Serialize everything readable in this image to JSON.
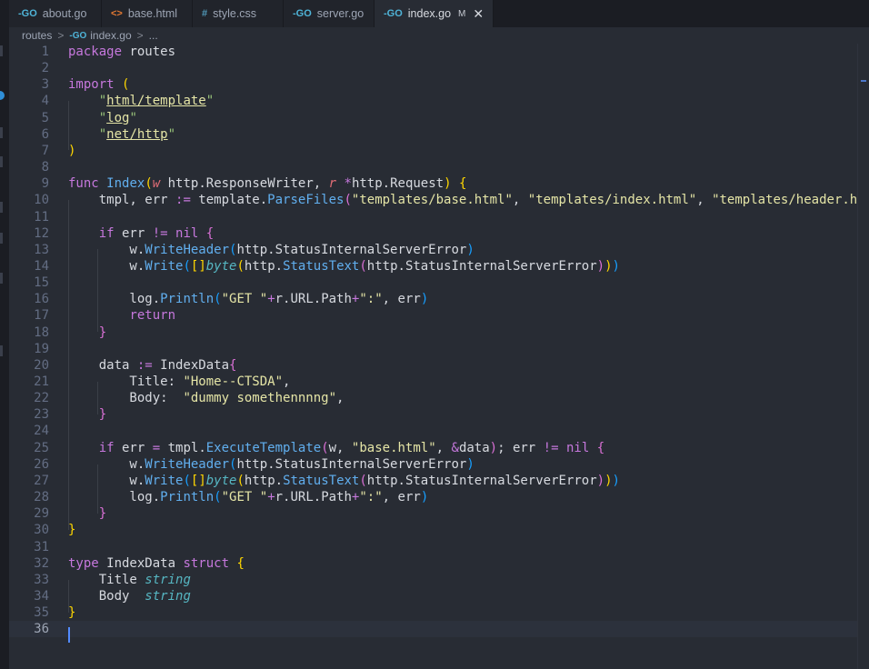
{
  "tabs": [
    {
      "icon": "go-icon",
      "icon_text": "-GO",
      "label": "about.go",
      "active": false
    },
    {
      "icon": "html-icon",
      "icon_text": "<>",
      "label": "base.html",
      "active": false
    },
    {
      "icon": "css-icon",
      "icon_text": "#",
      "label": "style.css",
      "active": false
    },
    {
      "icon": "go-icon",
      "icon_text": "-GO",
      "label": "server.go",
      "active": false
    },
    {
      "icon": "go-icon",
      "icon_text": "-GO",
      "label": "index.go",
      "active": true,
      "modified": "M",
      "close": "✕"
    }
  ],
  "breadcrumb": {
    "folder": "routes",
    "sep": ">",
    "file_icon_text": "-GO",
    "file": "index.go",
    "tail": "..."
  },
  "editor": {
    "current_line": 36,
    "line_numbers": [
      "1",
      "2",
      "3",
      "4",
      "5",
      "6",
      "7",
      "8",
      "9",
      "10",
      "11",
      "12",
      "13",
      "14",
      "15",
      "16",
      "17",
      "18",
      "19",
      "20",
      "21",
      "22",
      "23",
      "24",
      "25",
      "26",
      "27",
      "28",
      "29",
      "30",
      "31",
      "32",
      "33",
      "34",
      "35",
      "36"
    ],
    "lines": [
      [
        [
          "kw",
          "package"
        ],
        [
          "pkg",
          " routes"
        ]
      ],
      [],
      [
        [
          "kw",
          "import"
        ],
        [
          "pkg",
          " "
        ],
        [
          "br1",
          "("
        ]
      ],
      [
        [
          "pkg",
          "    "
        ],
        [
          "strq",
          "\""
        ],
        [
          "str ul",
          "html/template"
        ],
        [
          "strq",
          "\""
        ]
      ],
      [
        [
          "pkg",
          "    "
        ],
        [
          "strq",
          "\""
        ],
        [
          "str ul",
          "log"
        ],
        [
          "strq",
          "\""
        ]
      ],
      [
        [
          "pkg",
          "    "
        ],
        [
          "strq",
          "\""
        ],
        [
          "str ul",
          "net/http"
        ],
        [
          "strq",
          "\""
        ]
      ],
      [
        [
          "br1",
          ")"
        ]
      ],
      [],
      [
        [
          "kw",
          "func"
        ],
        [
          "pkg",
          " "
        ],
        [
          "fn",
          "Index"
        ],
        [
          "br1",
          "("
        ],
        [
          "tpar",
          "w"
        ],
        [
          "pkg",
          " http.ResponseWriter, "
        ],
        [
          "tpar",
          "r"
        ],
        [
          "pkg",
          " "
        ],
        [
          "kw",
          "*"
        ],
        [
          "pkg",
          "http.Request"
        ],
        [
          "br1",
          ")"
        ],
        [
          "pkg",
          " "
        ],
        [
          "br1",
          "{"
        ]
      ],
      [
        [
          "pkg",
          "    tmpl, err "
        ],
        [
          "kw",
          ":="
        ],
        [
          "pkg",
          " template."
        ],
        [
          "fn",
          "ParseFiles"
        ],
        [
          "br2",
          "("
        ],
        [
          "str",
          "\"templates/base.html\""
        ],
        [
          "pkg",
          ", "
        ],
        [
          "str",
          "\"templates/index.html\""
        ],
        [
          "pkg",
          ", "
        ],
        [
          "str",
          "\"templates/header.html\""
        ],
        [
          "pkg",
          ","
        ]
      ],
      [],
      [
        [
          "pkg",
          "    "
        ],
        [
          "kw",
          "if"
        ],
        [
          "pkg",
          " err "
        ],
        [
          "kw",
          "!="
        ],
        [
          "pkg",
          " "
        ],
        [
          "kw",
          "nil"
        ],
        [
          "pkg",
          " "
        ],
        [
          "br2",
          "{"
        ]
      ],
      [
        [
          "pkg",
          "        w."
        ],
        [
          "fn",
          "WriteHeader"
        ],
        [
          "br3",
          "("
        ],
        [
          "pkg",
          "http.StatusInternalServerError"
        ],
        [
          "br3",
          ")"
        ]
      ],
      [
        [
          "pkg",
          "        w."
        ],
        [
          "fn",
          "Write"
        ],
        [
          "br3",
          "("
        ],
        [
          "br1",
          "[]"
        ],
        [
          "ty",
          "byte"
        ],
        [
          "br1",
          "("
        ],
        [
          "pkg",
          "http."
        ],
        [
          "fn",
          "StatusText"
        ],
        [
          "br2",
          "("
        ],
        [
          "pkg",
          "http.StatusInternalServerError"
        ],
        [
          "br2",
          ")"
        ],
        [
          "br1",
          ")"
        ],
        [
          "br3",
          ")"
        ]
      ],
      [],
      [
        [
          "pkg",
          "        log."
        ],
        [
          "fn",
          "Println"
        ],
        [
          "br3",
          "("
        ],
        [
          "str",
          "\"GET \""
        ],
        [
          "kw",
          "+"
        ],
        [
          "pkg",
          "r.URL.Path"
        ],
        [
          "kw",
          "+"
        ],
        [
          "str",
          "\":\""
        ],
        [
          "pkg",
          ", err"
        ],
        [
          "br3",
          ")"
        ]
      ],
      [
        [
          "pkg",
          "        "
        ],
        [
          "kw",
          "return"
        ]
      ],
      [
        [
          "pkg",
          "    "
        ],
        [
          "br2",
          "}"
        ]
      ],
      [],
      [
        [
          "pkg",
          "    data "
        ],
        [
          "kw",
          ":="
        ],
        [
          "pkg",
          " IndexData"
        ],
        [
          "br2",
          "{"
        ]
      ],
      [
        [
          "pkg",
          "        Title: "
        ],
        [
          "str",
          "\"Home--CTSDA\""
        ],
        [
          "pkg",
          ","
        ]
      ],
      [
        [
          "pkg",
          "        Body:  "
        ],
        [
          "str",
          "\"dummy somethennnng\""
        ],
        [
          "pkg",
          ","
        ]
      ],
      [
        [
          "pkg",
          "    "
        ],
        [
          "br2",
          "}"
        ]
      ],
      [],
      [
        [
          "pkg",
          "    "
        ],
        [
          "kw",
          "if"
        ],
        [
          "pkg",
          " err "
        ],
        [
          "kw",
          "="
        ],
        [
          "pkg",
          " tmpl."
        ],
        [
          "fn",
          "ExecuteTemplate"
        ],
        [
          "br2",
          "("
        ],
        [
          "pkg",
          "w, "
        ],
        [
          "str",
          "\"base.html\""
        ],
        [
          "pkg",
          ", "
        ],
        [
          "kw",
          "&"
        ],
        [
          "pkg",
          "data"
        ],
        [
          "br2",
          ")"
        ],
        [
          "pkg",
          "; err "
        ],
        [
          "kw",
          "!="
        ],
        [
          "pkg",
          " "
        ],
        [
          "kw",
          "nil"
        ],
        [
          "pkg",
          " "
        ],
        [
          "br2",
          "{"
        ]
      ],
      [
        [
          "pkg",
          "        w."
        ],
        [
          "fn",
          "WriteHeader"
        ],
        [
          "br3",
          "("
        ],
        [
          "pkg",
          "http.StatusInternalServerError"
        ],
        [
          "br3",
          ")"
        ]
      ],
      [
        [
          "pkg",
          "        w."
        ],
        [
          "fn",
          "Write"
        ],
        [
          "br3",
          "("
        ],
        [
          "br1",
          "[]"
        ],
        [
          "ty",
          "byte"
        ],
        [
          "br1",
          "("
        ],
        [
          "pkg",
          "http."
        ],
        [
          "fn",
          "StatusText"
        ],
        [
          "br2",
          "("
        ],
        [
          "pkg",
          "http.StatusInternalServerError"
        ],
        [
          "br2",
          ")"
        ],
        [
          "br1",
          ")"
        ],
        [
          "br3",
          ")"
        ]
      ],
      [
        [
          "pkg",
          "        log."
        ],
        [
          "fn",
          "Println"
        ],
        [
          "br3",
          "("
        ],
        [
          "str",
          "\"GET \""
        ],
        [
          "kw",
          "+"
        ],
        [
          "pkg",
          "r.URL.Path"
        ],
        [
          "kw",
          "+"
        ],
        [
          "str",
          "\":\""
        ],
        [
          "pkg",
          ", err"
        ],
        [
          "br3",
          ")"
        ]
      ],
      [
        [
          "pkg",
          "    "
        ],
        [
          "br2",
          "}"
        ]
      ],
      [
        [
          "br1",
          "}"
        ]
      ],
      [],
      [
        [
          "kw",
          "type"
        ],
        [
          "pkg",
          " IndexData "
        ],
        [
          "kw",
          "struct"
        ],
        [
          "pkg",
          " "
        ],
        [
          "br1",
          "{"
        ]
      ],
      [
        [
          "pkg",
          "    Title "
        ],
        [
          "ty",
          "string"
        ]
      ],
      [
        [
          "pkg",
          "    Body  "
        ],
        [
          "ty",
          "string"
        ]
      ],
      [
        [
          "br1",
          "}"
        ]
      ],
      []
    ]
  },
  "colors": {
    "background": "#282c34",
    "keyword": "#c678dd",
    "function": "#61afef",
    "string": "#e5e5a6",
    "type": "#56b6c2"
  }
}
